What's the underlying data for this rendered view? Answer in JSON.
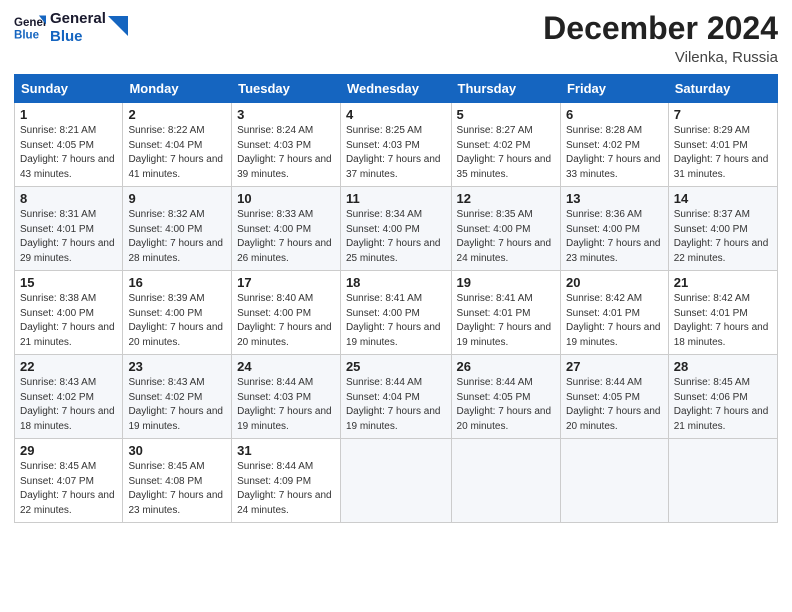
{
  "header": {
    "logo_line1": "General",
    "logo_line2": "Blue",
    "month": "December 2024",
    "location": "Vilenka, Russia"
  },
  "days_of_week": [
    "Sunday",
    "Monday",
    "Tuesday",
    "Wednesday",
    "Thursday",
    "Friday",
    "Saturday"
  ],
  "weeks": [
    [
      {
        "day": 1,
        "sunrise": "8:21 AM",
        "sunset": "4:05 PM",
        "daylight": "7 hours and 43 minutes."
      },
      {
        "day": 2,
        "sunrise": "8:22 AM",
        "sunset": "4:04 PM",
        "daylight": "7 hours and 41 minutes."
      },
      {
        "day": 3,
        "sunrise": "8:24 AM",
        "sunset": "4:03 PM",
        "daylight": "7 hours and 39 minutes."
      },
      {
        "day": 4,
        "sunrise": "8:25 AM",
        "sunset": "4:03 PM",
        "daylight": "7 hours and 37 minutes."
      },
      {
        "day": 5,
        "sunrise": "8:27 AM",
        "sunset": "4:02 PM",
        "daylight": "7 hours and 35 minutes."
      },
      {
        "day": 6,
        "sunrise": "8:28 AM",
        "sunset": "4:02 PM",
        "daylight": "7 hours and 33 minutes."
      },
      {
        "day": 7,
        "sunrise": "8:29 AM",
        "sunset": "4:01 PM",
        "daylight": "7 hours and 31 minutes."
      }
    ],
    [
      {
        "day": 8,
        "sunrise": "8:31 AM",
        "sunset": "4:01 PM",
        "daylight": "7 hours and 29 minutes."
      },
      {
        "day": 9,
        "sunrise": "8:32 AM",
        "sunset": "4:00 PM",
        "daylight": "7 hours and 28 minutes."
      },
      {
        "day": 10,
        "sunrise": "8:33 AM",
        "sunset": "4:00 PM",
        "daylight": "7 hours and 26 minutes."
      },
      {
        "day": 11,
        "sunrise": "8:34 AM",
        "sunset": "4:00 PM",
        "daylight": "7 hours and 25 minutes."
      },
      {
        "day": 12,
        "sunrise": "8:35 AM",
        "sunset": "4:00 PM",
        "daylight": "7 hours and 24 minutes."
      },
      {
        "day": 13,
        "sunrise": "8:36 AM",
        "sunset": "4:00 PM",
        "daylight": "7 hours and 23 minutes."
      },
      {
        "day": 14,
        "sunrise": "8:37 AM",
        "sunset": "4:00 PM",
        "daylight": "7 hours and 22 minutes."
      }
    ],
    [
      {
        "day": 15,
        "sunrise": "8:38 AM",
        "sunset": "4:00 PM",
        "daylight": "7 hours and 21 minutes."
      },
      {
        "day": 16,
        "sunrise": "8:39 AM",
        "sunset": "4:00 PM",
        "daylight": "7 hours and 20 minutes."
      },
      {
        "day": 17,
        "sunrise": "8:40 AM",
        "sunset": "4:00 PM",
        "daylight": "7 hours and 20 minutes."
      },
      {
        "day": 18,
        "sunrise": "8:41 AM",
        "sunset": "4:00 PM",
        "daylight": "7 hours and 19 minutes."
      },
      {
        "day": 19,
        "sunrise": "8:41 AM",
        "sunset": "4:01 PM",
        "daylight": "7 hours and 19 minutes."
      },
      {
        "day": 20,
        "sunrise": "8:42 AM",
        "sunset": "4:01 PM",
        "daylight": "7 hours and 19 minutes."
      },
      {
        "day": 21,
        "sunrise": "8:42 AM",
        "sunset": "4:01 PM",
        "daylight": "7 hours and 18 minutes."
      }
    ],
    [
      {
        "day": 22,
        "sunrise": "8:43 AM",
        "sunset": "4:02 PM",
        "daylight": "7 hours and 18 minutes."
      },
      {
        "day": 23,
        "sunrise": "8:43 AM",
        "sunset": "4:02 PM",
        "daylight": "7 hours and 19 minutes."
      },
      {
        "day": 24,
        "sunrise": "8:44 AM",
        "sunset": "4:03 PM",
        "daylight": "7 hours and 19 minutes."
      },
      {
        "day": 25,
        "sunrise": "8:44 AM",
        "sunset": "4:04 PM",
        "daylight": "7 hours and 19 minutes."
      },
      {
        "day": 26,
        "sunrise": "8:44 AM",
        "sunset": "4:05 PM",
        "daylight": "7 hours and 20 minutes."
      },
      {
        "day": 27,
        "sunrise": "8:44 AM",
        "sunset": "4:05 PM",
        "daylight": "7 hours and 20 minutes."
      },
      {
        "day": 28,
        "sunrise": "8:45 AM",
        "sunset": "4:06 PM",
        "daylight": "7 hours and 21 minutes."
      }
    ],
    [
      {
        "day": 29,
        "sunrise": "8:45 AM",
        "sunset": "4:07 PM",
        "daylight": "7 hours and 22 minutes."
      },
      {
        "day": 30,
        "sunrise": "8:45 AM",
        "sunset": "4:08 PM",
        "daylight": "7 hours and 23 minutes."
      },
      {
        "day": 31,
        "sunrise": "8:44 AM",
        "sunset": "4:09 PM",
        "daylight": "7 hours and 24 minutes."
      },
      null,
      null,
      null,
      null
    ]
  ]
}
